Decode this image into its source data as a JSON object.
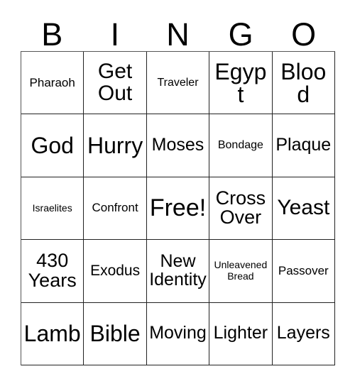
{
  "card": {
    "header_letters": [
      "B",
      "I",
      "N",
      "G",
      "O"
    ],
    "rows": [
      [
        {
          "text": "Pharaoh",
          "size": "sz-smp"
        },
        {
          "text": "Get Out",
          "size": "sz-xxl"
        },
        {
          "text": "Traveler",
          "size": "sz-sm"
        },
        {
          "text": "Egypt",
          "size": "sz-3xl"
        },
        {
          "text": "Blood",
          "size": "sz-3xl"
        }
      ],
      [
        {
          "text": "God",
          "size": "sz-3xl"
        },
        {
          "text": "Hurry",
          "size": "sz-3xl"
        },
        {
          "text": "Moses",
          "size": "sz-lg"
        },
        {
          "text": "Bondage",
          "size": "sz-sm"
        },
        {
          "text": "Plaque",
          "size": "sz-lg"
        }
      ],
      [
        {
          "text": "Israelites",
          "size": "sz-xs"
        },
        {
          "text": "Confront",
          "size": "sz-smp"
        },
        {
          "text": "Free!",
          "size": "sz-4xl"
        },
        {
          "text": "Cross Over",
          "size": "sz-xl"
        },
        {
          "text": "Yeast",
          "size": "sz-xxl"
        }
      ],
      [
        {
          "text": "430 Years",
          "size": "sz-xl"
        },
        {
          "text": "Exodus",
          "size": "sz-md"
        },
        {
          "text": "New Identity",
          "size": "sz-lg"
        },
        {
          "text": "Unleavened Bread",
          "size": "sz-xs"
        },
        {
          "text": "Passover",
          "size": "sz-smp"
        }
      ],
      [
        {
          "text": "Lamb",
          "size": "sz-3xl"
        },
        {
          "text": "Bible",
          "size": "sz-3xl"
        },
        {
          "text": "Moving",
          "size": "sz-lg"
        },
        {
          "text": "Lighter",
          "size": "sz-lg"
        },
        {
          "text": "Layers",
          "size": "sz-lg"
        }
      ]
    ]
  },
  "colors": {
    "background": "#ffffff",
    "text": "#000000",
    "grid_line": "#222222"
  }
}
